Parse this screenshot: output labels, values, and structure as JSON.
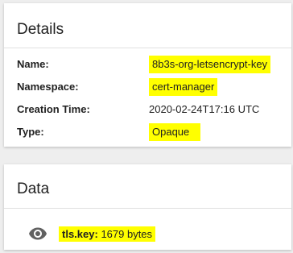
{
  "details": {
    "title": "Details",
    "fields": [
      {
        "label": "Name:",
        "value": "8b3s-org-letsencrypt-key"
      },
      {
        "label": "Namespace:",
        "value": "cert-manager"
      },
      {
        "label": "Creation Time:",
        "value": "2020-02-24T17:16 UTC"
      },
      {
        "label": "Type:",
        "value": "Opaque"
      }
    ]
  },
  "data": {
    "title": "Data",
    "items": [
      {
        "key": "tls.key:",
        "size": "1679 bytes",
        "icon": "eye-icon"
      }
    ]
  },
  "colors": {
    "highlight": "#ffff00",
    "icon": "#616161",
    "background": "#eeeeee",
    "card": "#ffffff"
  }
}
